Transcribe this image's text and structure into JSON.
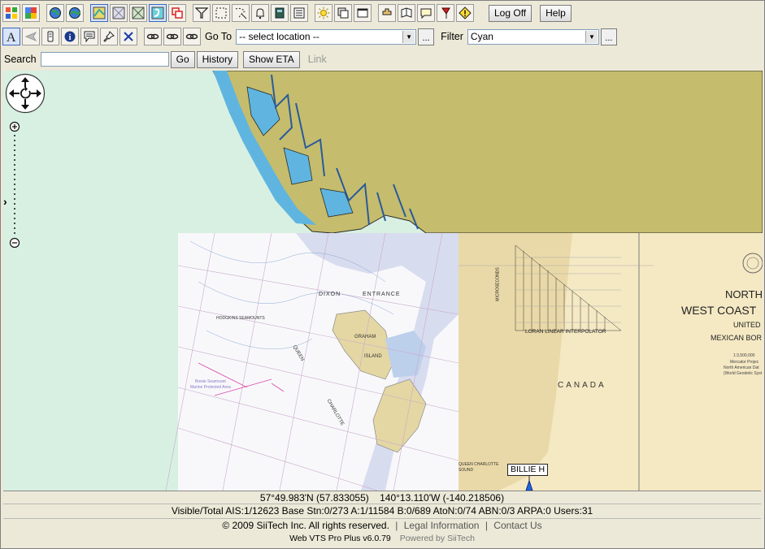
{
  "toolbar1": {
    "icons": [
      "windows-icon",
      "google-icon",
      "globe-1-icon",
      "globe-2-icon",
      "layer-yellow-icon",
      "layer-grid-icon",
      "layer-cross-icon",
      "layer-cyan-icon",
      "layer-red-icon",
      "filter-icon",
      "select-rect-icon",
      "lasso-icon",
      "bell-icon",
      "ship-icon",
      "list-icon",
      "sun-icon",
      "windows-stack-icon",
      "window-icon",
      "pan-icon",
      "book-icon",
      "note-icon",
      "flag-icon",
      "warning-icon"
    ],
    "logoff_label": "Log Off",
    "help_label": "Help"
  },
  "toolbar2": {
    "goto_label": "Go To",
    "goto_value": "-- select location --",
    "filter_label": "Filter",
    "filter_value": "Cyan",
    "dots_label": "..."
  },
  "toolbar3": {
    "search_label": "Search",
    "go_label": "Go",
    "history_label": "History",
    "show_eta_label": "Show ETA",
    "link_label": "Link"
  },
  "map": {
    "chart_labels": {
      "dixon": "DIXON",
      "entrance": "ENTRANCE",
      "hodgkins": "HODGKINS SEAMOUNTS",
      "graham": "GRAHAM",
      "island": "ISLAND",
      "queen": "QUEEN",
      "charlotte": "CHARLOTTE",
      "bowie": "Bowie Seamount",
      "mpa": "Marine Protected Area",
      "canada": "CANADA",
      "qc_sound": "QUEEN CHARLOTTE SOUND",
      "loran": "LORAN LINEAR INTERPOLATOR",
      "microseconds": "MICROSECONDS",
      "north": "NORTH",
      "west_coast": "WEST COAST",
      "united": "UNITED",
      "mexican_bor": "MEXICAN BOR",
      "scale": "1:3,500,000",
      "projection": "Mercator Projec",
      "datum": "North American Dat",
      "geodetic": "(World Geodetic Syst"
    },
    "vessel_label": "BILLIE H"
  },
  "status": {
    "coords": "57°49.983'N (57.833055)    140°13.110'W (-140.218506)",
    "counts": "Visible/Total AIS:1/12623  Base Stn:0/273  A:1/11584  B:0/689  AtoN:0/74  ABN:0/3  ARPA:0  Users:31",
    "copyright": "© 2009 SiiTech Inc. All rights reserved.",
    "legal": "Legal Information",
    "contact": "Contact Us",
    "version": "Web VTS Pro Plus v6.0.79",
    "powered": "Powered by SiiTech"
  }
}
